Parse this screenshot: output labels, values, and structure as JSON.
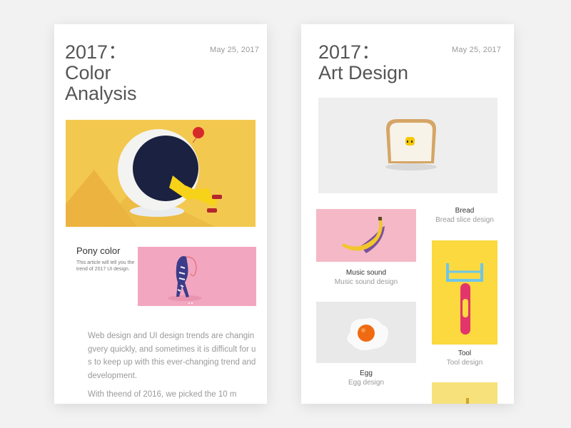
{
  "card1": {
    "title": "2017：\nColor\nAnalysis",
    "date": "May 25, 2017",
    "section_title": "Pony color",
    "section_desc": "This article will tell you the trend of 2017 UI design.",
    "paragraph1": "Web design and UI design trends are changingvery quickly, and sometimes it is difficult for us to keep up with this ever-changing trend and development.",
    "paragraph2": "With theend of 2016, we picked the 10 m",
    "colors": {
      "hero_bg": "#f3c84f",
      "pony_bg": "#f3a6c0"
    }
  },
  "card2": {
    "title": "2017：\nArt Design",
    "date": "May 25, 2017",
    "items": [
      {
        "title": "Bread",
        "subtitle": "Bread slice design"
      },
      {
        "title": "Music sound",
        "subtitle": "Music sound design"
      },
      {
        "title": "Tool",
        "subtitle": "Tool design"
      },
      {
        "title": "Egg",
        "subtitle": "Egg design"
      }
    ],
    "colors": {
      "bread_bg": "#eeeeee",
      "banana_bg": "#f4b8c6",
      "tool_bg": "#fbd93f",
      "egg_bg": "#e9e9e9",
      "bottom_bg": "#f7e17a"
    }
  }
}
